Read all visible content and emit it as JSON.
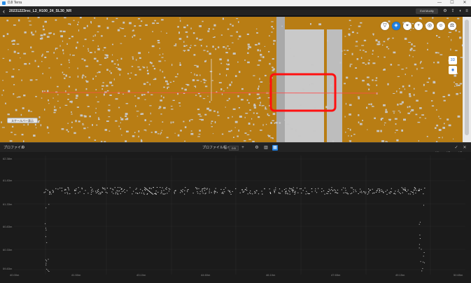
{
  "app": {
    "name": "DJI Terra"
  },
  "header": {
    "back_label": "‹",
    "file_title": "20231223rec_L2_H100_24_SL30_NR",
    "edit_button": "Exit Modify",
    "icons": [
      "measure-icon",
      "share-icon",
      "settings-icon",
      "menu-icon"
    ]
  },
  "window_controls": {
    "minimize": "—",
    "maximize": "☐",
    "close": "✕"
  },
  "view": {
    "toolbar": [
      "filter-icon",
      "layers-icon",
      "pin-icon",
      "tree-icon",
      "camera-icon",
      "person-icon",
      "ruler-icon"
    ],
    "side_tools": {
      "zoom_label": "3D",
      "locate_label": "◉"
    },
    "scale_label": "スケールバー表示",
    "colors": {
      "ground": "#b87d14",
      "points": "#c7c7c7",
      "highlight": "#ff1010",
      "profile_line": "#ff4040"
    }
  },
  "profile_panel": {
    "title": "プロファイル",
    "width_label": "プロファイル幅 m",
    "width_value": "0.5",
    "toggles": [
      "XY",
      "XZ",
      "YZ"
    ],
    "y_ticks": [
      "62.38m",
      "61.83m",
      "61.33m",
      "60.83m",
      "60.33m",
      "59.83m"
    ],
    "x_ticks": [
      "40.00m",
      "41.50m",
      "43.10m",
      "44.60m",
      "46.10m",
      "47.65m",
      "49.15m",
      "50.65m",
      "52.15m"
    ]
  }
}
